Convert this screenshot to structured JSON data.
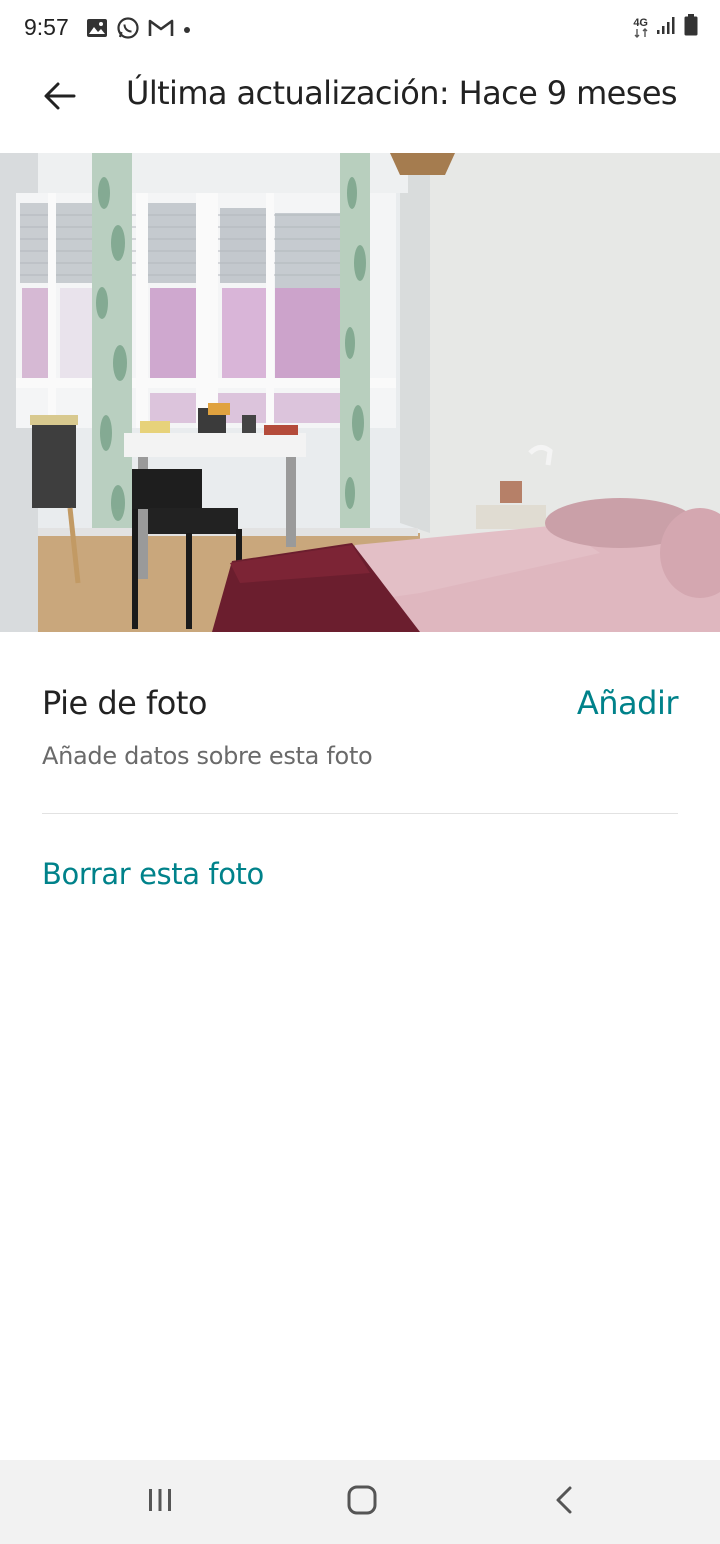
{
  "status_bar": {
    "time": "9:57",
    "network_label": "4G",
    "left_icons": [
      "image-icon",
      "whatsapp-icon",
      "gmail-icon",
      "dot-icon"
    ],
    "right_icons": [
      "network-4g-icon",
      "signal-icon",
      "battery-icon"
    ]
  },
  "app_bar": {
    "title": "Última actualización: Hace 9 meses",
    "back_icon": "arrow-left-icon"
  },
  "photo": {
    "edit_icon": "pencil-icon"
  },
  "caption": {
    "label": "Pie de foto",
    "add_label": "Añadir",
    "helper": "Añade datos sobre esta foto"
  },
  "actions": {
    "delete_label": "Borrar esta foto"
  },
  "colors": {
    "accent": "#00828a",
    "text_primary": "#222222",
    "text_secondary": "#6a6a6a",
    "divider": "#e2e2e2",
    "nav_bar_bg": "#f2f2f2"
  },
  "nav_bar": {
    "buttons": [
      "recent-apps-icon",
      "home-icon",
      "back-icon"
    ]
  }
}
